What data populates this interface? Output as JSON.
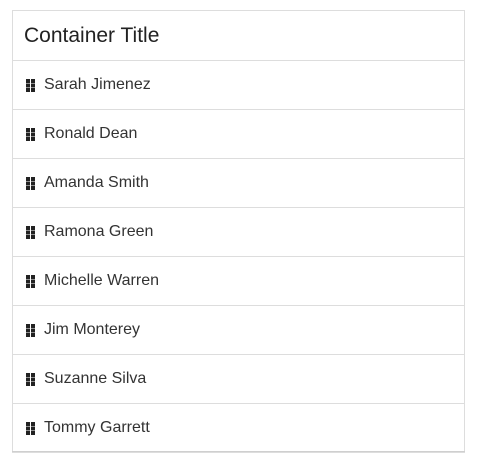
{
  "container": {
    "title": "Container Title"
  },
  "items": [
    {
      "name": "Sarah Jimenez",
      "icon": "drag-handle-icon"
    },
    {
      "name": "Ronald Dean",
      "icon": "drag-handle-icon"
    },
    {
      "name": "Amanda Smith",
      "icon": "drag-handle-icon"
    },
    {
      "name": "Ramona Green",
      "icon": "drag-handle-icon"
    },
    {
      "name": "Michelle Warren",
      "icon": "drag-handle-icon"
    },
    {
      "name": "Jim Monterey",
      "icon": "drag-handle-icon"
    },
    {
      "name": "Suzanne Silva",
      "icon": "drag-handle-icon"
    },
    {
      "name": "Tommy Garrett",
      "icon": "drag-handle-icon"
    }
  ],
  "colors": {
    "border": "#dddddd",
    "text": "#333333",
    "handle": "#222222"
  }
}
